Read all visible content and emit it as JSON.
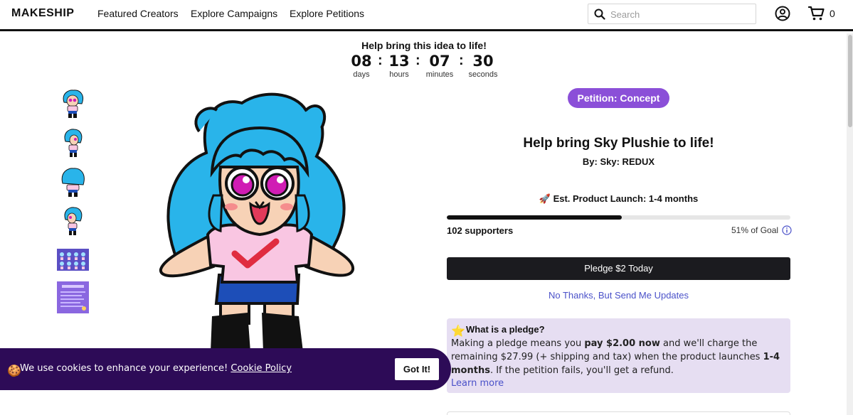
{
  "header": {
    "logo": "MAKESHIP",
    "nav": [
      "Featured Creators",
      "Explore Campaigns",
      "Explore Petitions"
    ],
    "search_placeholder": "Search",
    "cart_count": "0"
  },
  "countdown": {
    "title": "Help bring this idea to life!",
    "units": [
      {
        "value": "08",
        "label": "days"
      },
      {
        "value": "13",
        "label": "hours"
      },
      {
        "value": "07",
        "label": "minutes"
      },
      {
        "value": "30",
        "label": "seconds"
      }
    ]
  },
  "product": {
    "badge": "Petition: Concept",
    "title": "Help bring Sky Plushie to life!",
    "byline": "By: Sky: REDUX",
    "launch": "Est. Product Launch: 1-4 months",
    "launch_icon": "🚀",
    "supporters": "102 supporters",
    "goal": "51% of Goal",
    "progress_fraction": 0.51,
    "pledge_button": "Pledge $2 Today",
    "updates_link": "No Thanks, But Send Me Updates"
  },
  "pledge_info": {
    "icon": "⭐",
    "question": "What is a pledge?",
    "text_1": "Making a pledge means you ",
    "bold_1": "pay $2.00 now",
    "text_2": " and we'll charge the remaining $27.99 (+ shipping and tax) when the product launches ",
    "bold_2": "1-4 months",
    "text_3": ". If the petition fails, you'll get a refund.",
    "learn_more": "Learn more"
  },
  "cookie": {
    "icon": "🍪",
    "text": "We use cookies to enhance your experience! ",
    "link": "Cookie Policy",
    "button": "Got It!"
  },
  "colors": {
    "badge": "#8b4fd8",
    "cookie_bg": "#2d0b57",
    "link": "#4a51c9",
    "info_bg": "#e6def2",
    "hair": "#29b4ea",
    "eyes": "#d01cb4"
  }
}
